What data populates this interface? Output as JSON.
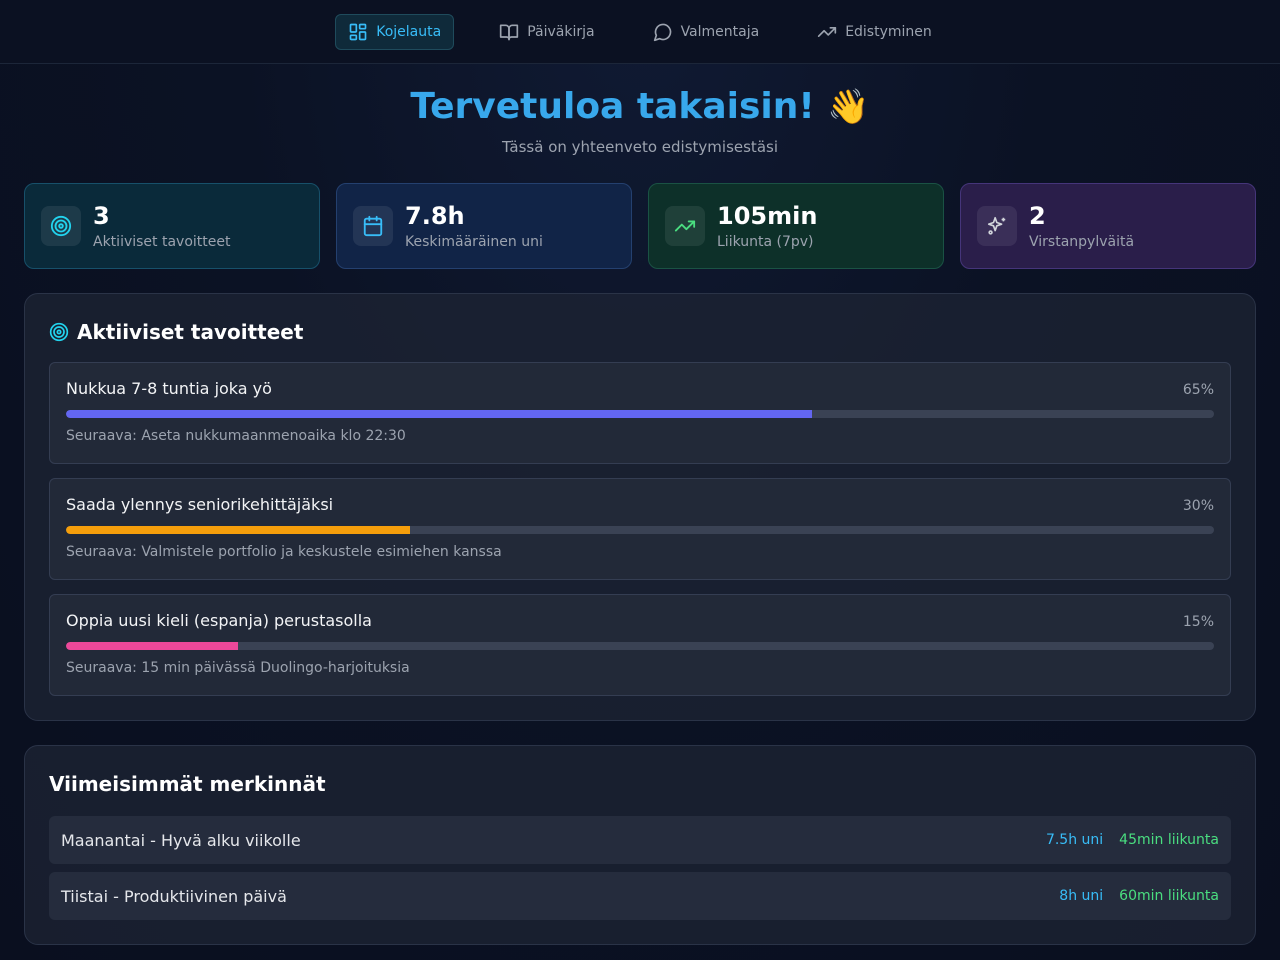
{
  "nav": {
    "items": [
      {
        "label": "Kojelauta",
        "icon": "dashboard-icon",
        "active": true
      },
      {
        "label": "Päiväkirja",
        "icon": "book-icon",
        "active": false
      },
      {
        "label": "Valmentaja",
        "icon": "chat-bubble-icon",
        "active": false
      },
      {
        "label": "Edistyminen",
        "icon": "trending-up-icon",
        "active": false
      }
    ]
  },
  "hero": {
    "title": "Tervetuloa takaisin!",
    "emoji": "👋",
    "subtitle": "Tässä on yhteenveto edistymisestäsi"
  },
  "stats": [
    {
      "value": "3",
      "label": "Aktiiviset tavoitteet",
      "icon": "target-icon",
      "accent": "#22d3ee"
    },
    {
      "value": "7.8h",
      "label": "Keskimääräinen uni",
      "icon": "calendar-icon",
      "accent": "#38bdf8"
    },
    {
      "value": "105min",
      "label": "Liikunta (7pv)",
      "icon": "trending-up-icon",
      "accent": "#4ade80"
    },
    {
      "value": "2",
      "label": "Virstanpylväitä",
      "icon": "sparkles-icon",
      "accent": "#d1d5db"
    }
  ],
  "goals": {
    "title": "Aktiiviset tavoitteet",
    "items": [
      {
        "title": "Nukkua 7-8 tuntia joka yö",
        "percent_label": "65%",
        "progress": 0.65,
        "color": "#6366f1",
        "next": "Seuraava: Aseta nukkumaanmenoaika klo 22:30"
      },
      {
        "title": "Saada ylennys seniorikehittäjäksi",
        "percent_label": "30%",
        "progress": 0.3,
        "color": "#f59e0b",
        "next": "Seuraava: Valmistele portfolio ja keskustele esimiehen kanssa"
      },
      {
        "title": "Oppia uusi kieli (espanja) perustasolla",
        "percent_label": "15%",
        "progress": 0.15,
        "color": "#ec4899",
        "next": "Seuraava: 15 min päivässä Duolingo-harjoituksia"
      }
    ]
  },
  "entries": {
    "title": "Viimeisimmät merkinnät",
    "items": [
      {
        "title": "Maanantai - Hyvä alku viikolle",
        "sleep": "7.5h uni",
        "exercise": "45min liikunta"
      },
      {
        "title": "Tiistai - Produktiivinen päivä",
        "sleep": "8h uni",
        "exercise": "60min liikunta"
      }
    ]
  }
}
